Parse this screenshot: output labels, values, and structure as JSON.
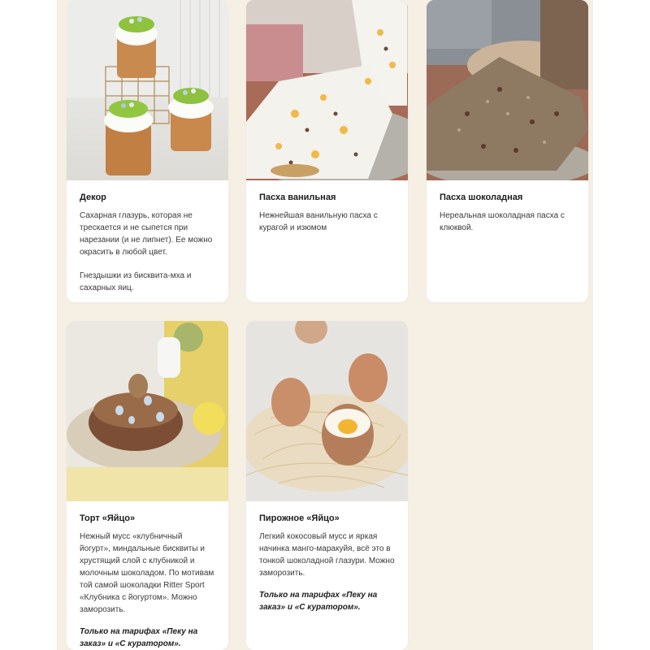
{
  "cards": [
    {
      "title": "Декор",
      "desc": [
        "Сахарная глазурь, которая не трескается и не сыпется при нарезании (и не липнет). Ее можно окрасить в любой цвет.",
        "Гнездышки из бисквита-мха и сахарных яиц."
      ]
    },
    {
      "title": "Пасха ванильная",
      "desc": [
        "Нежнейшая ванильную пасха с курагой и изюмом"
      ]
    },
    {
      "title": "Пасха шоколадная",
      "desc": [
        "Нереальная шоколадная пасха с клюквой."
      ]
    },
    {
      "title": "Торт «Яйцо»",
      "desc": [
        "Нежный мусс «клубничный йогурт», миндальные бисквиты и хрустящий слой с клубникой и молочным шоколадом. По мотивам той самой шоколадки Ritter Sport «Клубника с йогуртом». Можно заморозить."
      ],
      "note": "Только на тарифах «Пеку на заказ» и «С куратором»."
    },
    {
      "title": "Пирожное «Яйцо»",
      "desc": [
        "Легкий кокосовый мусс и яркая начинка манго-маракуйя, всё это в тонкой шоколадной глазури. Можно заморозить."
      ],
      "note": "Только на тарифах «Пеку на заказ» и «С куратором»."
    }
  ],
  "colors": {
    "page_background": "#f5efe4",
    "card_background": "#ffffff",
    "title_text": "#1d1d1d",
    "body_text": "#3a3a3a"
  }
}
